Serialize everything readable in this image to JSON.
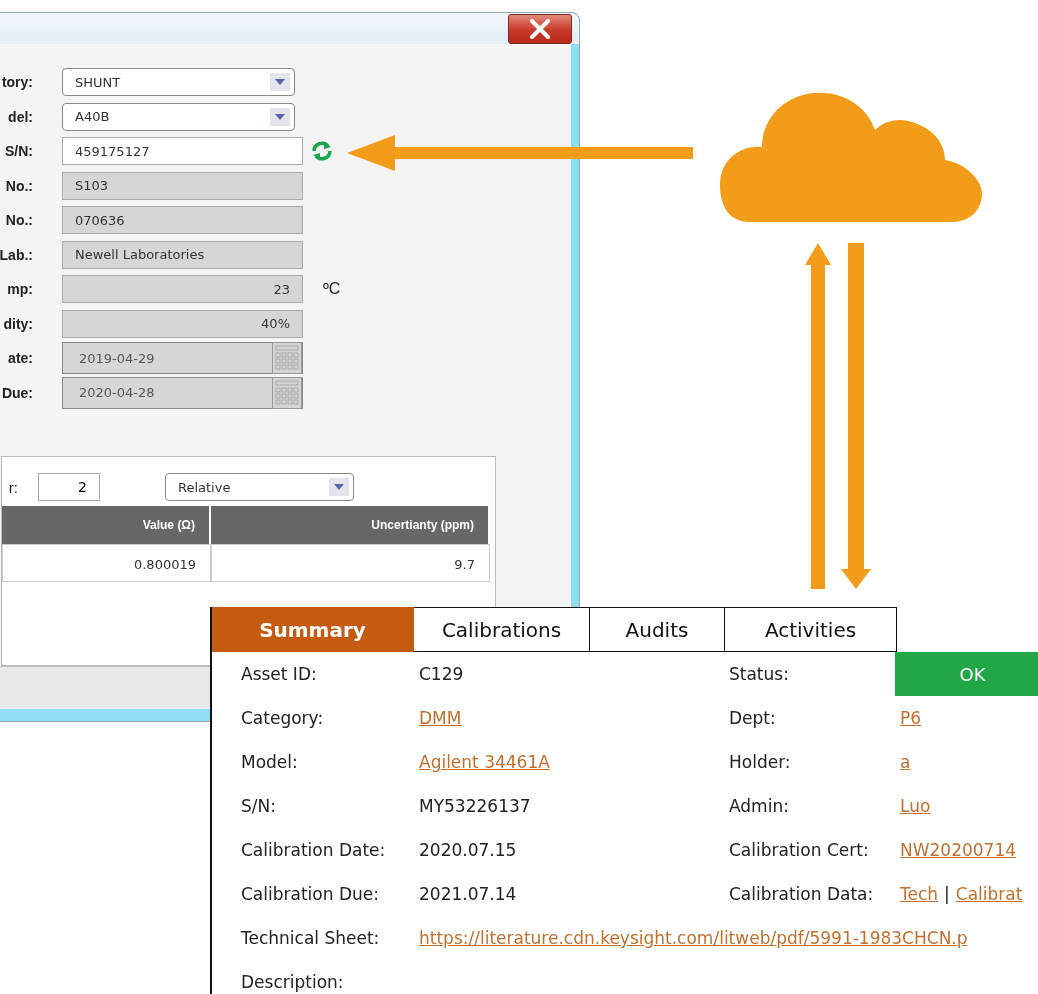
{
  "dialog": {
    "fields": [
      {
        "label": "tory:",
        "kind": "dropdown",
        "value": "SHUNT"
      },
      {
        "label": "del:",
        "kind": "dropdown",
        "value": "A40B"
      },
      {
        "label": "S/N:",
        "kind": "input",
        "value": "459175127",
        "refresh": true
      },
      {
        "label": "No.:",
        "kind": "readonly",
        "value": "S103"
      },
      {
        "label": "No.:",
        "kind": "readonly",
        "value": "070636"
      },
      {
        "label": "Lab.:",
        "kind": "readonly",
        "value": "Newell Laboratories"
      },
      {
        "label": "mp:",
        "kind": "number",
        "value": "23",
        "unit": "ºC"
      },
      {
        "label": "dity:",
        "kind": "number",
        "value": "40%"
      },
      {
        "label": "ate:",
        "kind": "date",
        "value": "2019-04-29"
      },
      {
        "label": "Due:",
        "kind": "date",
        "value": "2020-04-28"
      }
    ],
    "coverage": {
      "label": "r:",
      "factor": "2",
      "mode": "Relative"
    },
    "table": {
      "columns": [
        "Value (Ω)",
        "Uncertianty (ppm)"
      ],
      "rows": [
        [
          "0.800019",
          "9.7"
        ]
      ]
    }
  },
  "summary": {
    "tabs": [
      {
        "label": "Summary",
        "selected": true
      },
      {
        "label": "Calibrations",
        "selected": false
      },
      {
        "label": "Audits",
        "selected": false
      },
      {
        "label": "Activities",
        "selected": false
      }
    ],
    "rows": [
      {
        "left": {
          "label": "Asset ID:",
          "parts": [
            {
              "text": "C129",
              "link": false
            }
          ]
        },
        "right": {
          "label": "Status:",
          "kind": "status",
          "parts": [
            {
              "text": "OK",
              "link": false
            }
          ]
        }
      },
      {
        "left": {
          "label": "Category:",
          "parts": [
            {
              "text": "DMM",
              "link": true
            }
          ]
        },
        "right": {
          "label": "Dept:",
          "kind": "text",
          "parts": [
            {
              "text": "P6",
              "link": true
            }
          ]
        }
      },
      {
        "left": {
          "label": "Model:",
          "parts": [
            {
              "text": "Agilent 34461A",
              "link": true
            }
          ]
        },
        "right": {
          "label": "Holder:",
          "kind": "text",
          "parts": [
            {
              "text": "a",
              "link": true
            }
          ]
        }
      },
      {
        "left": {
          "label": "S/N:",
          "parts": [
            {
              "text": "MY53226137",
              "link": false
            }
          ]
        },
        "right": {
          "label": "Admin:",
          "kind": "text",
          "parts": [
            {
              "text": "Luo",
              "link": true
            }
          ]
        }
      },
      {
        "left": {
          "label": "Calibration Date:",
          "parts": [
            {
              "text": "2020.07.15",
              "link": false
            }
          ]
        },
        "right": {
          "label": "Calibration Cert:",
          "kind": "text",
          "parts": [
            {
              "text": "NW20200714",
              "link": true
            }
          ]
        }
      },
      {
        "left": {
          "label": "Calibration Due:",
          "parts": [
            {
              "text": "2021.07.14",
              "link": false
            }
          ]
        },
        "right": {
          "label": "Calibration Data:",
          "kind": "text",
          "parts": [
            {
              "text": "Tech",
              "link": true
            },
            {
              "text": "|",
              "link": false
            },
            {
              "text": "Calibrat",
              "link": true
            }
          ]
        }
      },
      {
        "left": {
          "label": "Technical Sheet:",
          "parts": [
            {
              "text": "https://literature.cdn.keysight.com/litweb/pdf/5991-1983CHCN.p",
              "link": true
            }
          ]
        }
      },
      {
        "left": {
          "label": "Description:"
        }
      }
    ]
  }
}
